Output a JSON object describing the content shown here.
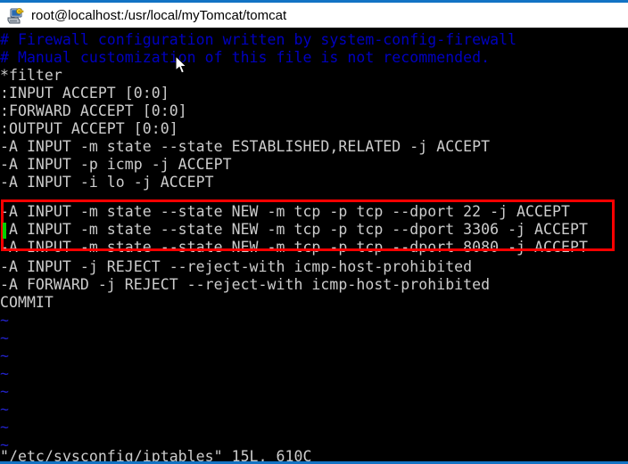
{
  "window": {
    "title": "root@localhost:/usr/local/myTomcat/tomcat",
    "icon": "putty-terminal-icon",
    "accent_color": "#1273c4",
    "titlebar_bg": "#ffffff",
    "terminal_bg": "#000000"
  },
  "editor": {
    "app": "vim",
    "comment_color": "#0000c0",
    "text_color": "#cccccc",
    "tilde_color": "#2222c8",
    "cursor_color": "#00d000",
    "lines": [
      {
        "id": 1,
        "text": "# Firewall configuration written by system-config-firewall",
        "style": "comment"
      },
      {
        "id": 2,
        "text": "# Manual customization of this file is not recommended.",
        "style": "comment"
      },
      {
        "id": 3,
        "text": "*filter",
        "style": "normal"
      },
      {
        "id": 4,
        "text": ":INPUT ACCEPT [0:0]",
        "style": "normal"
      },
      {
        "id": 5,
        "text": ":FORWARD ACCEPT [0:0]",
        "style": "normal"
      },
      {
        "id": 6,
        "text": ":OUTPUT ACCEPT [0:0]",
        "style": "normal"
      },
      {
        "id": 7,
        "text": "-A INPUT -m state --state ESTABLISHED,RELATED -j ACCEPT",
        "style": "normal"
      },
      {
        "id": 8,
        "text": "-A INPUT -p icmp -j ACCEPT",
        "style": "normal"
      },
      {
        "id": 9,
        "text": "-A INPUT -i lo -j ACCEPT",
        "style": "normal"
      },
      {
        "id": 10,
        "text": "-A INPUT -m state --state NEW -m tcp -p tcp --dport 22 -j ACCEPT",
        "style": "normal"
      },
      {
        "id": 11,
        "text": "-A INPUT -m state --state NEW -m tcp -p tcp --dport 3306 -j ACCEPT",
        "style": "normal"
      },
      {
        "id": 12,
        "text": "-A INPUT -m state --state NEW -m tcp -p tcp --dport 8080 -j ACCEPT",
        "style": "normal"
      },
      {
        "id": 13,
        "text": "-A INPUT -j REJECT --reject-with icmp-host-prohibited",
        "style": "normal"
      },
      {
        "id": 14,
        "text": "-A FORWARD -j REJECT --reject-with icmp-host-prohibited",
        "style": "normal"
      },
      {
        "id": 15,
        "text": "COMMIT",
        "style": "normal"
      },
      {
        "id": 16,
        "text": "~",
        "style": "tilde"
      },
      {
        "id": 17,
        "text": "~",
        "style": "tilde"
      },
      {
        "id": 18,
        "text": "~",
        "style": "tilde"
      },
      {
        "id": 19,
        "text": "~",
        "style": "tilde"
      },
      {
        "id": 20,
        "text": "~",
        "style": "tilde"
      },
      {
        "id": 21,
        "text": "~",
        "style": "tilde"
      },
      {
        "id": 22,
        "text": "~",
        "style": "tilde"
      },
      {
        "id": 23,
        "text": "~",
        "style": "tilde"
      }
    ],
    "status_line": "\"/etc/sysconfig/iptables\" 15L, 610C"
  },
  "annotation": {
    "type": "red-rectangle-highlight",
    "color": "#fe0000",
    "covers_lines": [
      10,
      11,
      12
    ]
  },
  "cursor": {
    "mouse_pointer": "arrow-cursor",
    "vim_cursor_line": 11
  }
}
